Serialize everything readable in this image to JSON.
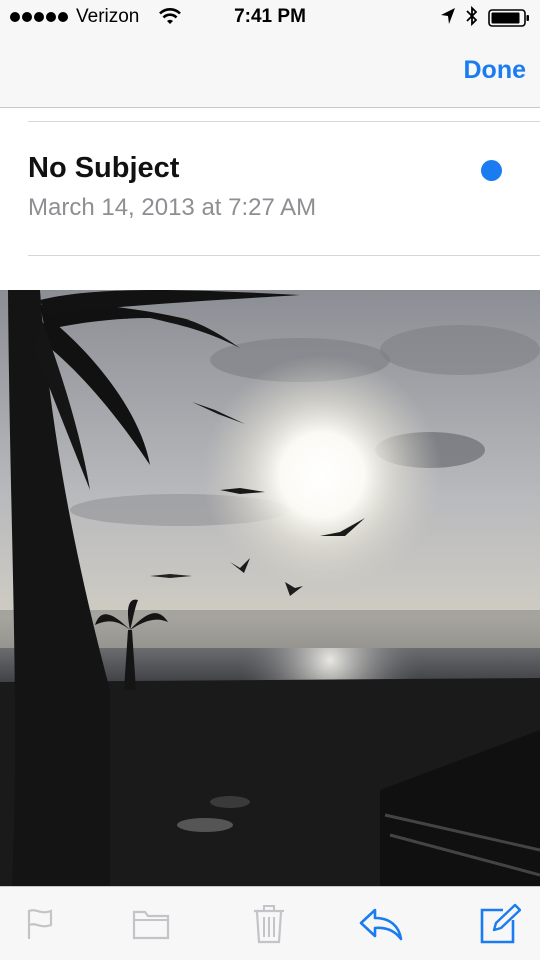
{
  "status_bar": {
    "carrier": "Verizon",
    "time": "7:41 PM"
  },
  "nav": {
    "done_label": "Done"
  },
  "message": {
    "subject": "No Subject",
    "date": "March 14, 2013 at 7:27 AM",
    "unread": true
  },
  "colors": {
    "accent": "#1a7cf0",
    "disabled": "#c4c4c8",
    "secondary_text": "#8e8e93"
  },
  "toolbar": {
    "items": [
      {
        "icon": "flag-icon",
        "enabled": false
      },
      {
        "icon": "folder-icon",
        "enabled": false
      },
      {
        "icon": "trash-icon",
        "enabled": false
      },
      {
        "icon": "reply-icon",
        "enabled": true
      },
      {
        "icon": "compose-icon",
        "enabled": true
      }
    ]
  }
}
